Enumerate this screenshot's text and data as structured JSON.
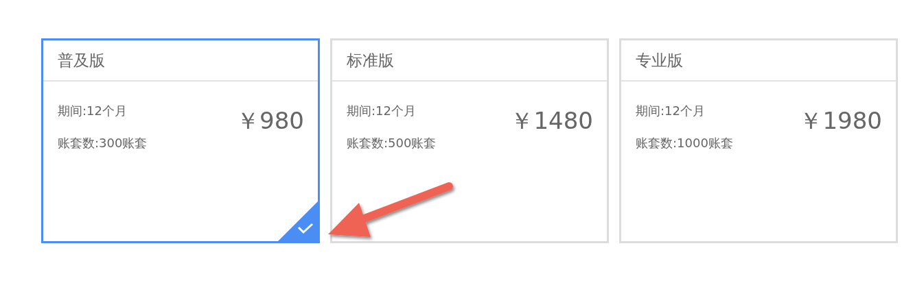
{
  "plans": [
    {
      "title": "普及版",
      "period": "期间:12个月",
      "accounts": "账套数:300账套",
      "price": "￥980",
      "selected": true
    },
    {
      "title": "标准版",
      "period": "期间:12个月",
      "accounts": "账套数:500账套",
      "price": "￥1480",
      "selected": false
    },
    {
      "title": "专业版",
      "period": "期间:12个月",
      "accounts": "账套数:1000账套",
      "price": "￥1980",
      "selected": false
    }
  ]
}
